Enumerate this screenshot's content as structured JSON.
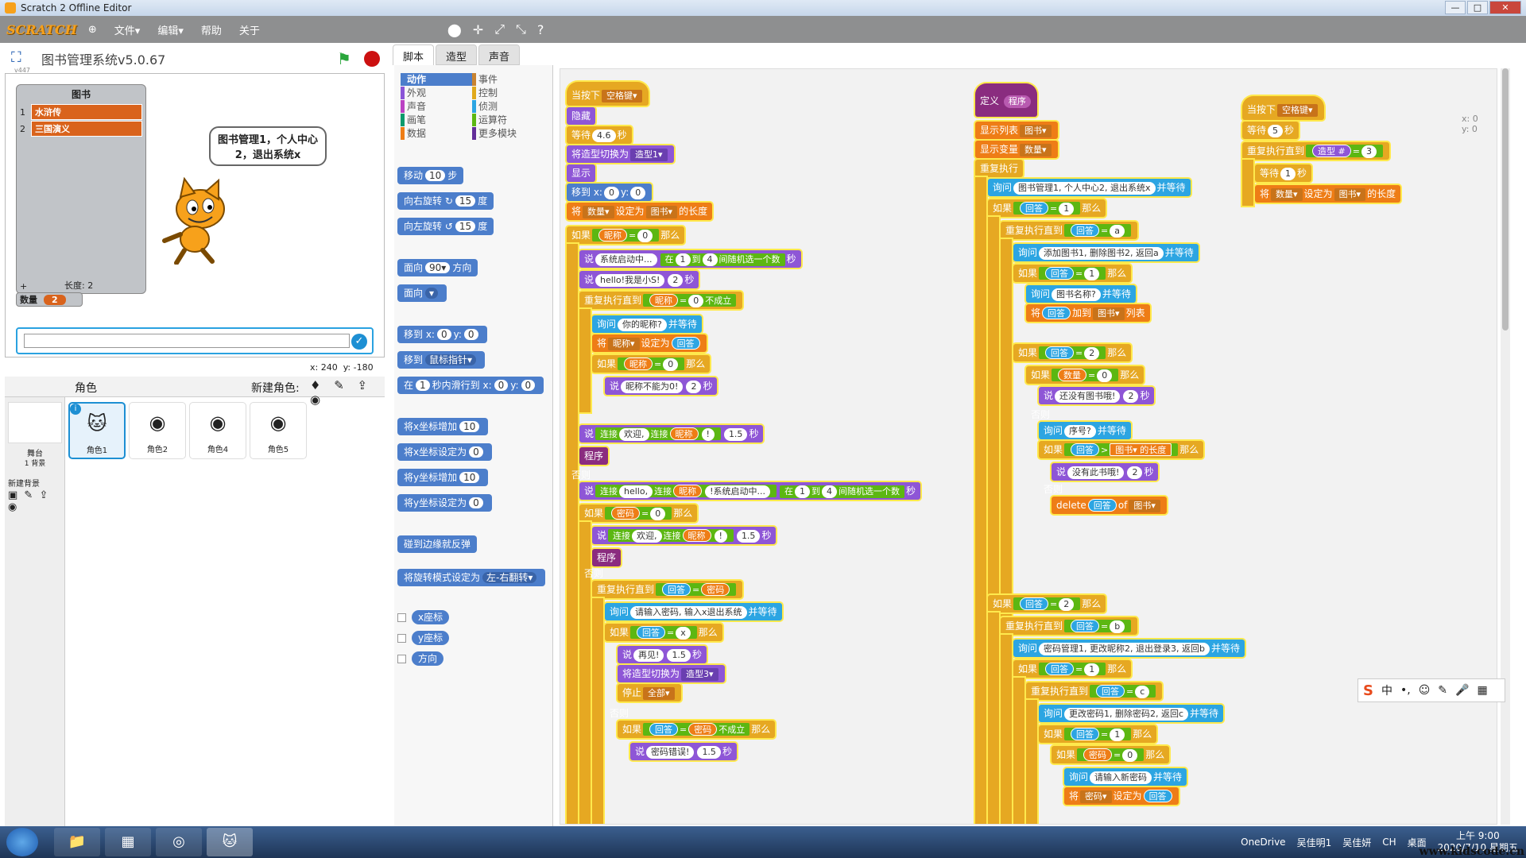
{
  "window": {
    "title": "Scratch 2 Offline Editor",
    "min": "—",
    "max": "□",
    "close": "✕"
  },
  "menu": {
    "logo": "SCRATCH",
    "globe": "⊕",
    "file": "文件▾",
    "edit": "编辑▾",
    "help": "帮助",
    "about": "关于",
    "tools": [
      "⬤",
      "✛",
      "⤢",
      "⤡",
      "?"
    ]
  },
  "stage": {
    "project_title": "图书管理系统v5.0.67",
    "version": "v447",
    "list_title": "图书",
    "list_items": [
      {
        "n": "1",
        "v": "水浒传"
      },
      {
        "n": "2",
        "v": "三国演义"
      }
    ],
    "list_len_label": "长度: 2",
    "list_plus": "+",
    "bubble": "图书管理1，个人中心2，退出系统x",
    "var_name": "数量",
    "var_value": "2",
    "coord_x": "x: 240",
    "coord_y": "y: -180",
    "ask_ok": "✓"
  },
  "sprites": {
    "title": "角色",
    "new_sprite": "新建角色:",
    "new_icons": "♦ ✎ ⇪ ◉",
    "stage_label": "舞台",
    "stage_sub": "1 背景",
    "new_backdrop": "新建背景",
    "backdrop_icons": "▣ ✎ ⇪ ◉",
    "items": [
      {
        "name": "角色1",
        "icon": "🐱",
        "info": "i"
      },
      {
        "name": "角色2",
        "icon": "◉"
      },
      {
        "name": "角色4",
        "icon": "◉"
      },
      {
        "name": "角色5",
        "icon": "◉"
      }
    ]
  },
  "tabs": [
    "脚本",
    "造型",
    "声音"
  ],
  "categories": [
    {
      "label": "动作",
      "color": "#4c7ecb"
    },
    {
      "label": "事件",
      "color": "#c88330"
    },
    {
      "label": "外观",
      "color": "#8a55d7"
    },
    {
      "label": "控制",
      "color": "#e1a91a"
    },
    {
      "label": "声音",
      "color": "#bb42c3"
    },
    {
      "label": "侦测",
      "color": "#2ca5e2"
    },
    {
      "label": "画笔",
      "color": "#0e9a6c"
    },
    {
      "label": "运算符",
      "color": "#5cb712"
    },
    {
      "label": "数据",
      "color": "#ee7d16"
    },
    {
      "label": "更多模块",
      "color": "#632d99"
    }
  ],
  "palette": {
    "move": [
      "移动",
      "10",
      "步"
    ],
    "turn_r": [
      "向右旋转",
      "↻",
      "15",
      "度"
    ],
    "turn_l": [
      "向左旋转",
      "↺",
      "15",
      "度"
    ],
    "point_dir": [
      "面向",
      "90▾",
      "方向"
    ],
    "point_to": [
      "面向",
      "▾"
    ],
    "goto_xy": [
      "移到 x:",
      "0",
      "y:",
      "0"
    ],
    "goto": [
      "移到",
      "鼠标指针▾"
    ],
    "glide": [
      "在",
      "1",
      "秒内滑行到 x:",
      "0",
      "y:",
      "0"
    ],
    "chg_x": [
      "将x坐标增加",
      "10"
    ],
    "set_x": [
      "将x坐标设定为",
      "0"
    ],
    "chg_y": [
      "将y坐标增加",
      "10"
    ],
    "set_y": [
      "将y坐标设定为",
      "0"
    ],
    "bounce": "碰到边缘就反弹",
    "rot": [
      "将旋转模式设定为",
      "左-右翻转▾"
    ],
    "xpos": "x座标",
    "ypos": "y座标",
    "dir": "方向"
  },
  "script": {
    "xy": [
      "x: 0",
      "y: 0"
    ],
    "s1": {
      "hat": [
        "当按下",
        "空格键▾"
      ],
      "hide": "隐藏",
      "wait": [
        "等待",
        "4.6",
        "秒"
      ],
      "costume": [
        "将造型切换为",
        "造型1▾"
      ],
      "show": "显示",
      "goto": [
        "移到 x:",
        "0",
        "y:",
        "0"
      ],
      "set": [
        "将",
        "数量▾",
        "设定为",
        "图书▾",
        "的长度"
      ],
      "if1": [
        "如果",
        "昵称",
        "=",
        "0",
        "那么"
      ],
      "say1": [
        "说",
        "系统启动中...",
        "在",
        "1",
        "到",
        "4",
        "间随机选一个数",
        "秒"
      ],
      "say2": [
        "说",
        "hello!我是小S!",
        "2",
        "秒"
      ],
      "rep1": [
        "重复执行直到",
        "昵称",
        "=",
        "0",
        "不成立"
      ],
      "ask1": [
        "询问",
        "你的昵称?",
        "并等待"
      ],
      "set2": [
        "将",
        "昵称▾",
        "设定为",
        "回答"
      ],
      "if2": [
        "如果",
        "昵称",
        "=",
        "0",
        "那么"
      ],
      "say3": [
        "说",
        "昵称不能为0!",
        "2",
        "秒"
      ],
      "say4": [
        "说",
        "连接",
        "欢迎,",
        "连接",
        "昵称",
        "!",
        "1.5",
        "秒"
      ],
      "prog": "程序",
      "else1": "否则",
      "say5": [
        "说",
        "连接",
        "hello,",
        "连接",
        "昵称",
        "!系统启动中...",
        "在",
        "1",
        "到",
        "4",
        "间随机选一个数",
        "秒"
      ],
      "if3": [
        "如果",
        "密码",
        "=",
        "0",
        "那么"
      ],
      "say6": [
        "说",
        "连接",
        "欢迎,",
        "连接",
        "昵称",
        "!",
        "1.5",
        "秒"
      ],
      "prog2": "程序",
      "else2": "否则",
      "rep2": [
        "重复执行直到",
        "回答",
        "=",
        "密码"
      ],
      "ask2": [
        "询问",
        "请输入密码, 输入x退出系统",
        "并等待"
      ],
      "if4": [
        "如果",
        "回答",
        "=",
        "x",
        "那么"
      ],
      "say7": [
        "说",
        "再见!",
        "1.5",
        "秒"
      ],
      "cos2": [
        "将造型切换为",
        "造型3▾"
      ],
      "stop": [
        "停止",
        "全部▾"
      ],
      "else3": "否则",
      "if5": [
        "如果",
        "回答",
        "=",
        "密码",
        "不成立",
        "那么"
      ],
      "say8": [
        "说",
        "密码错误!",
        "1.5",
        "秒"
      ]
    },
    "s2": {
      "def": [
        "定义",
        "程序"
      ],
      "showlist": [
        "显示列表",
        "图书▾"
      ],
      "showvar": [
        "显示变量",
        "数量▾"
      ],
      "forever": "重复执行",
      "ask": [
        "询问",
        "图书管理1, 个人中心2, 退出系统x",
        "并等待"
      ],
      "if1": [
        "如果",
        "回答",
        "=",
        "1",
        "那么"
      ],
      "rep1": [
        "重复执行直到",
        "回答",
        "=",
        "a"
      ],
      "ask2": [
        "询问",
        "添加图书1, 删除图书2, 返回a",
        "并等待"
      ],
      "if2": [
        "如果",
        "回答",
        "=",
        "1",
        "那么"
      ],
      "ask3": [
        "询问",
        "图书名称?",
        "并等待"
      ],
      "add": [
        "将",
        "回答",
        "加到",
        "图书▾",
        "列表"
      ],
      "if3": [
        "如果",
        "回答",
        "=",
        "2",
        "那么"
      ],
      "if4": [
        "如果",
        "数量",
        "=",
        "0",
        "那么"
      ],
      "say1": [
        "说",
        "还没有图书哦!",
        "2",
        "秒"
      ],
      "else1": "否则",
      "ask4": [
        "询问",
        "序号?",
        "并等待"
      ],
      "if5": [
        "如果",
        "回答",
        ">",
        "图书▾",
        "的长度",
        "那么"
      ],
      "say2": [
        "说",
        "没有此书哦!",
        "2",
        "秒"
      ],
      "else2": "否则",
      "del": [
        "delete",
        "回答",
        "of",
        "图书▾"
      ],
      "if6": [
        "如果",
        "回答",
        "=",
        "2",
        "那么"
      ],
      "rep2": [
        "重复执行直到",
        "回答",
        "=",
        "b"
      ],
      "ask5": [
        "询问",
        "密码管理1, 更改昵称2, 退出登录3, 返回b",
        "并等待"
      ],
      "if7": [
        "如果",
        "回答",
        "=",
        "1",
        "那么"
      ],
      "rep3": [
        "重复执行直到",
        "回答",
        "=",
        "c"
      ],
      "ask6": [
        "询问",
        "更改密码1, 删除密码2, 返回c",
        "并等待"
      ],
      "if8": [
        "如果",
        "回答",
        "=",
        "1",
        "那么"
      ],
      "if9": [
        "如果",
        "密码",
        "=",
        "0",
        "那么"
      ],
      "ask7": [
        "询问",
        "请输入新密码",
        "并等待"
      ],
      "set": [
        "将",
        "密码▾",
        "设定为",
        "回答"
      ]
    },
    "s3": {
      "hat": [
        "当按下",
        "空格键▾"
      ],
      "wait": [
        "等待",
        "5",
        "秒"
      ],
      "rep": [
        "重复执行直到",
        "造型",
        "#",
        "=",
        "3"
      ],
      "wait2": [
        "等待",
        "1",
        "秒"
      ],
      "set": [
        "将",
        "数量▾",
        "设定为",
        "图书▾",
        "的长度"
      ]
    }
  },
  "ime": {
    "logo": "S",
    "lang": "中",
    "items": [
      "•,",
      "☺",
      "✎",
      "🎤",
      "▦"
    ]
  },
  "taskbar": {
    "apps": [
      "📁",
      "▦",
      "◎",
      "🐱"
    ],
    "tray": [
      "OneDrive",
      "吴佳明1",
      "吴佳妍",
      "CH",
      "桌面"
    ],
    "time": "上午 9:00",
    "date": "2020/7/10 星期五",
    "watermark": "www.kidscode.cn"
  }
}
